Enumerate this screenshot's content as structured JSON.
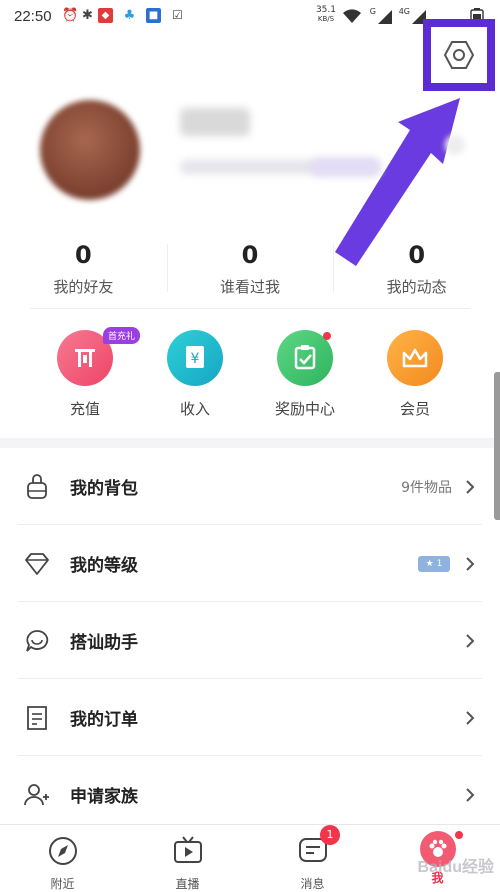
{
  "status_bar": {
    "time": "22:50",
    "net_speed": "35.1",
    "net_unit": "KB/S",
    "signal_1": "G",
    "signal_2": "4G"
  },
  "stats": [
    {
      "value": "0",
      "label": "我的好友"
    },
    {
      "value": "0",
      "label": "谁看过我"
    },
    {
      "value": "0",
      "label": "我的动态"
    }
  ],
  "quick_actions": [
    {
      "label": "充值",
      "tag": "首充礼",
      "color": "#f2587a"
    },
    {
      "label": "收入",
      "color": "#1fb7c9"
    },
    {
      "label": "奖励中心",
      "color": "#3cc46a"
    },
    {
      "label": "会员",
      "color": "#f5962e"
    }
  ],
  "menu": [
    {
      "label": "我的背包",
      "extra": "9件物品"
    },
    {
      "label": "我的等级",
      "level_badge": "1"
    },
    {
      "label": "搭讪助手"
    },
    {
      "label": "我的订单"
    },
    {
      "label": "申请家族"
    }
  ],
  "tabs": [
    {
      "label": "附近"
    },
    {
      "label": "直播"
    },
    {
      "label": "消息",
      "badge": "1"
    },
    {
      "label": "我"
    }
  ],
  "watermark": "Baidu经验",
  "colors": {
    "highlight": "#5b2bd6",
    "accent": "#e8324d"
  }
}
